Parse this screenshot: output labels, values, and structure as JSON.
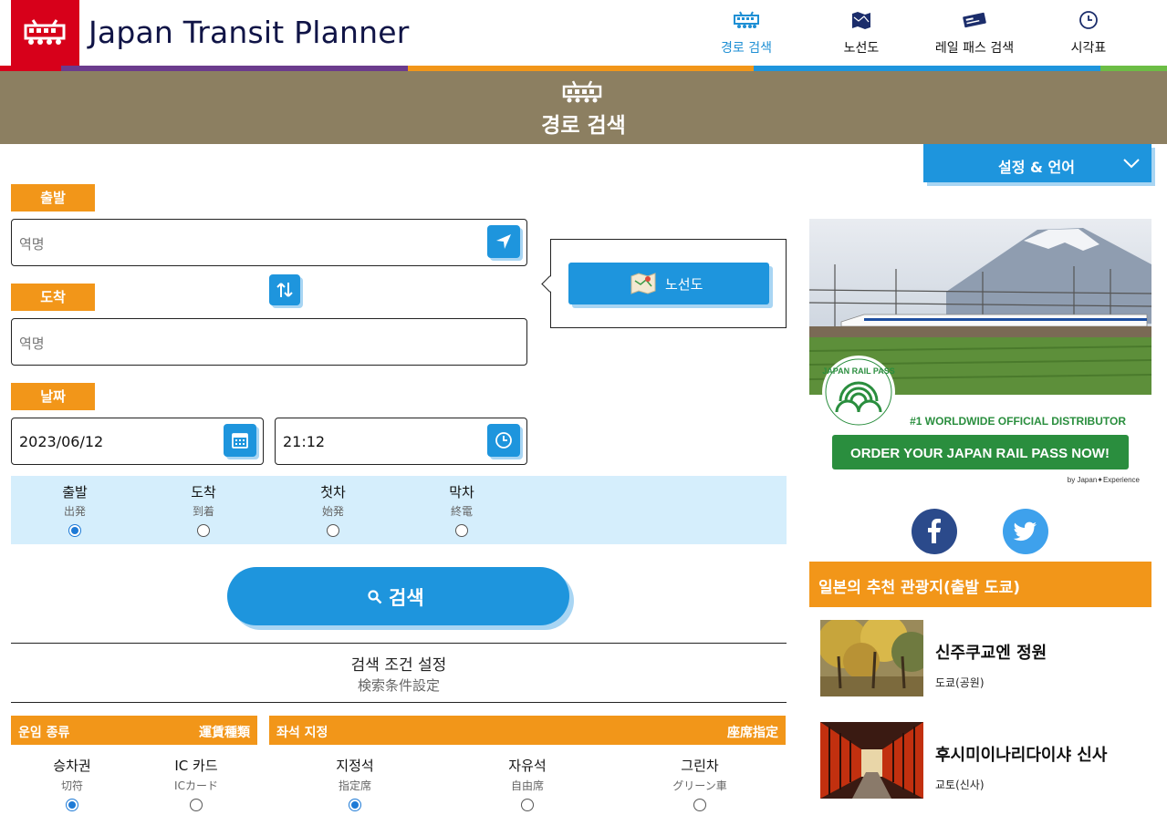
{
  "app": {
    "title": "Japan Transit Planner"
  },
  "nav": [
    {
      "label": "경로 검색",
      "icon": "train-icon",
      "active": true
    },
    {
      "label": "노선도",
      "icon": "map-icon",
      "active": false
    },
    {
      "label": "레일 패스 검색",
      "icon": "ticket-icon",
      "active": false
    },
    {
      "label": "시각표",
      "icon": "clock-icon",
      "active": false
    }
  ],
  "banner": {
    "title": "경로 검색"
  },
  "settings": {
    "label": "설정 & 언어"
  },
  "form": {
    "departure_label": "출발",
    "arrival_label": "도착",
    "date_label": "날짜",
    "station_placeholder": "역명",
    "date_value": "2023/06/12",
    "time_value": "21:12",
    "map_button": "노선도",
    "search_button": "검색"
  },
  "time_options": [
    {
      "ko": "출발",
      "ja": "出発",
      "selected": true
    },
    {
      "ko": "도착",
      "ja": "到着",
      "selected": false
    },
    {
      "ko": "첫차",
      "ja": "始発",
      "selected": false
    },
    {
      "ko": "막차",
      "ja": "終電",
      "selected": false
    }
  ],
  "conditions": {
    "title": "검색 조건 설정",
    "subtitle": "検索条件設定",
    "fare": {
      "title": "운임 종류",
      "title_ja": "運賃種類",
      "options": [
        {
          "ko": "승차권",
          "ja": "切符",
          "selected": true
        },
        {
          "ko": "IC 카드",
          "ja": "ICカード",
          "selected": false
        }
      ]
    },
    "seat": {
      "title": "좌석 지정",
      "title_ja": "座席指定",
      "options": [
        {
          "ko": "지정석",
          "ja": "指定席",
          "selected": true
        },
        {
          "ko": "자유석",
          "ja": "自由席",
          "selected": false
        },
        {
          "ko": "그린차",
          "ja": "グリーン車",
          "selected": false
        }
      ]
    }
  },
  "ad": {
    "logo_text": "JAPAN RAIL PASS",
    "tagline": "#1 WORLDWIDE OFFICIAL DISTRIBUTOR",
    "cta": "ORDER YOUR JAPAN RAIL PASS NOW!",
    "by": "by Japan✦Experience"
  },
  "social": [
    {
      "icon": "facebook-icon",
      "color": "#2b4a8b"
    },
    {
      "icon": "twitter-icon",
      "color": "#3ea1ec"
    }
  ],
  "recommend": {
    "title": "일본의 추천 관광지(출발 도쿄)",
    "items": [
      {
        "name": "신주쿠교엔 정원",
        "category": "도쿄(공원)"
      },
      {
        "name": "후시미이나리다이샤 신사",
        "category": "교토(신사)"
      }
    ]
  },
  "colors": {
    "brand_red": "#d7001a",
    "primary_blue": "#1e95dd",
    "accent_orange": "#f29619",
    "banner_brown": "#8c7f61",
    "option_bg": "#d5eefc"
  }
}
